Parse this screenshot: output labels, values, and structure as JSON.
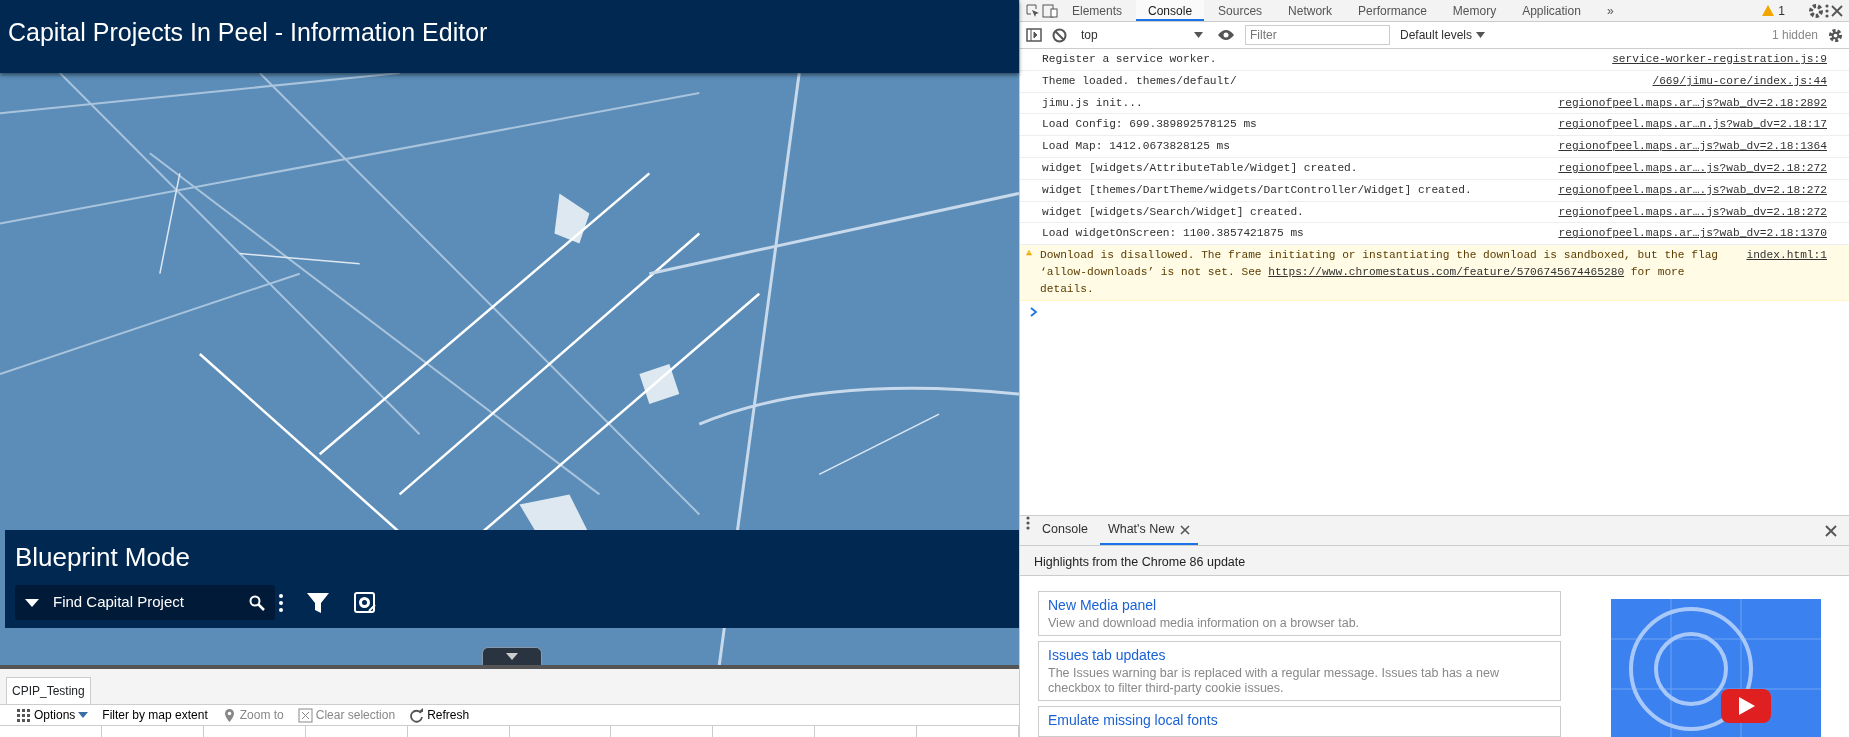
{
  "app": {
    "title": "Capital Projects In Peel - Information Editor"
  },
  "blueprint": {
    "title": "Blueprint Mode",
    "search": {
      "placeholder": "Find Capital Project"
    }
  },
  "attribute_table": {
    "tabs": [
      {
        "label": "CPIP_Testing",
        "selected": true
      }
    ],
    "toolbar": [
      {
        "kind": "options",
        "label": "Options",
        "disabled": false
      },
      {
        "kind": "plain",
        "label": "Filter by map extent",
        "disabled": false
      },
      {
        "kind": "pin",
        "label": "Zoom to",
        "disabled": true
      },
      {
        "kind": "clear",
        "label": "Clear selection",
        "disabled": true
      },
      {
        "kind": "refresh",
        "label": "Refresh",
        "disabled": false
      }
    ]
  },
  "devtools": {
    "tabs": [
      {
        "label": "Elements",
        "selected": false
      },
      {
        "label": "Console",
        "selected": true
      },
      {
        "label": "Sources",
        "selected": false
      },
      {
        "label": "Network",
        "selected": false
      },
      {
        "label": "Performance",
        "selected": false
      },
      {
        "label": "Memory",
        "selected": false
      },
      {
        "label": "Application",
        "selected": false
      }
    ],
    "more_tabs": "»",
    "warning_count": "1",
    "context": "top",
    "filter": {
      "placeholder": "Filter"
    },
    "levels": "Default levels",
    "hidden": "1 hidden",
    "messages": [
      {
        "kind": "log",
        "text": "Register a service worker.",
        "source": "service-worker-registration.js:9"
      },
      {
        "kind": "log",
        "text": "Theme loaded. themes/default/",
        "source": "/669/jimu-core/index.js:44"
      },
      {
        "kind": "log",
        "text": "jimu.js init...",
        "source": "regionofpeel.maps.ar…js?wab_dv=2.18:2892"
      },
      {
        "kind": "log",
        "text": "Load Config: 699.389892578125 ms",
        "source": "regionofpeel.maps.ar…n.js?wab_dv=2.18:17"
      },
      {
        "kind": "log",
        "text": "Load Map: 1412.0673828125 ms",
        "source": "regionofpeel.maps.ar…js?wab_dv=2.18:1364"
      },
      {
        "kind": "log",
        "text": "widget [widgets/AttributeTable/Widget] created.",
        "source": "regionofpeel.maps.ar….js?wab_dv=2.18:272"
      },
      {
        "kind": "log",
        "text": "widget [themes/DartTheme/widgets/DartController/Widget] created.",
        "source": "regionofpeel.maps.ar….js?wab_dv=2.18:272"
      },
      {
        "kind": "log",
        "text": "widget [widgets/Search/Widget] created.",
        "source": "regionofpeel.maps.ar….js?wab_dv=2.18:272"
      },
      {
        "kind": "log",
        "text": "Load widgetOnScreen: 1100.3857421875 ms",
        "source": "regionofpeel.maps.ar…js?wab_dv=2.18:1370"
      },
      {
        "kind": "warning",
        "text": "Download is disallowed. The frame initiating or instantiating the download is sandboxed, but the flag ‘allow-downloads’ is not set. See ",
        "link": "https://www.chromestatus.com/feature/5706745674465280",
        "text_after": " for more details.",
        "source": "index.html:1"
      }
    ],
    "drawer": {
      "tabs": [
        {
          "label": "Console",
          "selected": false
        },
        {
          "label": "What's New",
          "selected": true
        }
      ],
      "heading": "Highlights from the Chrome 86 update",
      "features": [
        {
          "title": "New Media panel",
          "description": "View and download media information on a browser tab."
        },
        {
          "title": "Issues tab updates",
          "description": "The Issues warning bar is replaced with a regular message. Issues tab has a new checkbox to filter third-party cookie issues."
        },
        {
          "title": "Emulate missing local fonts"
        }
      ]
    }
  }
}
